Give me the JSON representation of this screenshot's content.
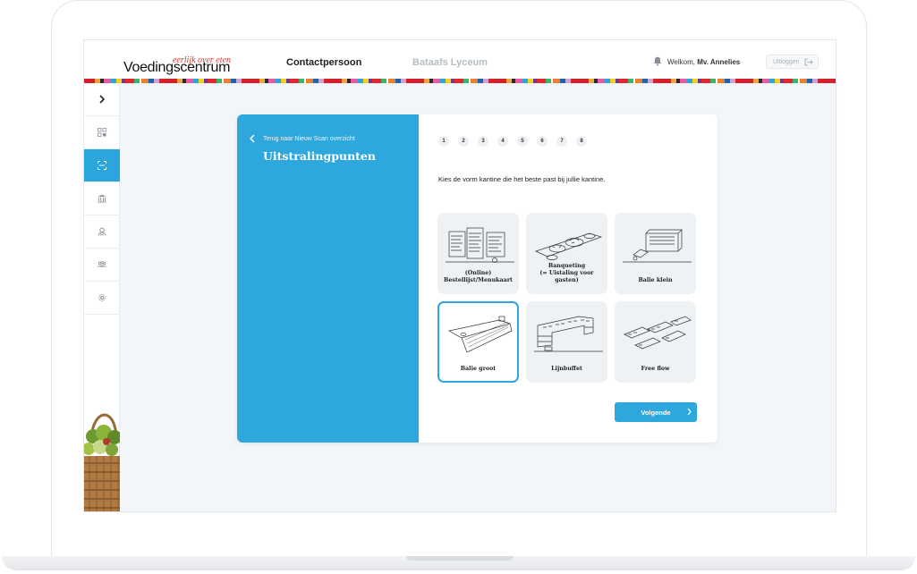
{
  "header": {
    "logo_tagline": "eerlijk over eten",
    "logo_name": "Voedingscentrum",
    "nav_active": "Contactpersoon",
    "nav_inactive": "Bataafs Lyceum",
    "welcome_prefix": "Welkom, ",
    "welcome_name": "Mv. Annelies",
    "logout_label": "Uitloggen"
  },
  "sidebar": {
    "items": [
      {
        "icon": "chevron-right-icon",
        "active": false
      },
      {
        "icon": "dashboard-icon",
        "active": false
      },
      {
        "icon": "scan-icon",
        "active": true
      },
      {
        "icon": "institution-icon",
        "active": false
      },
      {
        "icon": "contact-icon",
        "active": false
      },
      {
        "icon": "users-icon",
        "active": false
      },
      {
        "icon": "gear-icon",
        "active": false
      }
    ]
  },
  "card": {
    "back_label": "Terug naar Nieuw Scan overzicht",
    "title": "Uitstralingpunten",
    "steps": [
      "1",
      "2",
      "3",
      "4",
      "5",
      "6",
      "7",
      "8"
    ],
    "question": "Kies de vorm kantine die het beste past bij jullie kantine.",
    "options": [
      {
        "label": "(Online)\nBestellijst/Menukaart",
        "selected": false
      },
      {
        "label": "Banqueting\n(= Uistaling voor gasten)",
        "selected": false
      },
      {
        "label": "Balie klein",
        "selected": false
      },
      {
        "label": "Balie groot",
        "selected": true
      },
      {
        "label": "Lijnbuffet",
        "selected": false
      },
      {
        "label": "Free flow",
        "selected": false
      }
    ],
    "next_label": "Volgende"
  },
  "colors": {
    "accent": "#2ea7dd",
    "brand_red": "#d63a2f",
    "background": "#f3f6f9"
  }
}
